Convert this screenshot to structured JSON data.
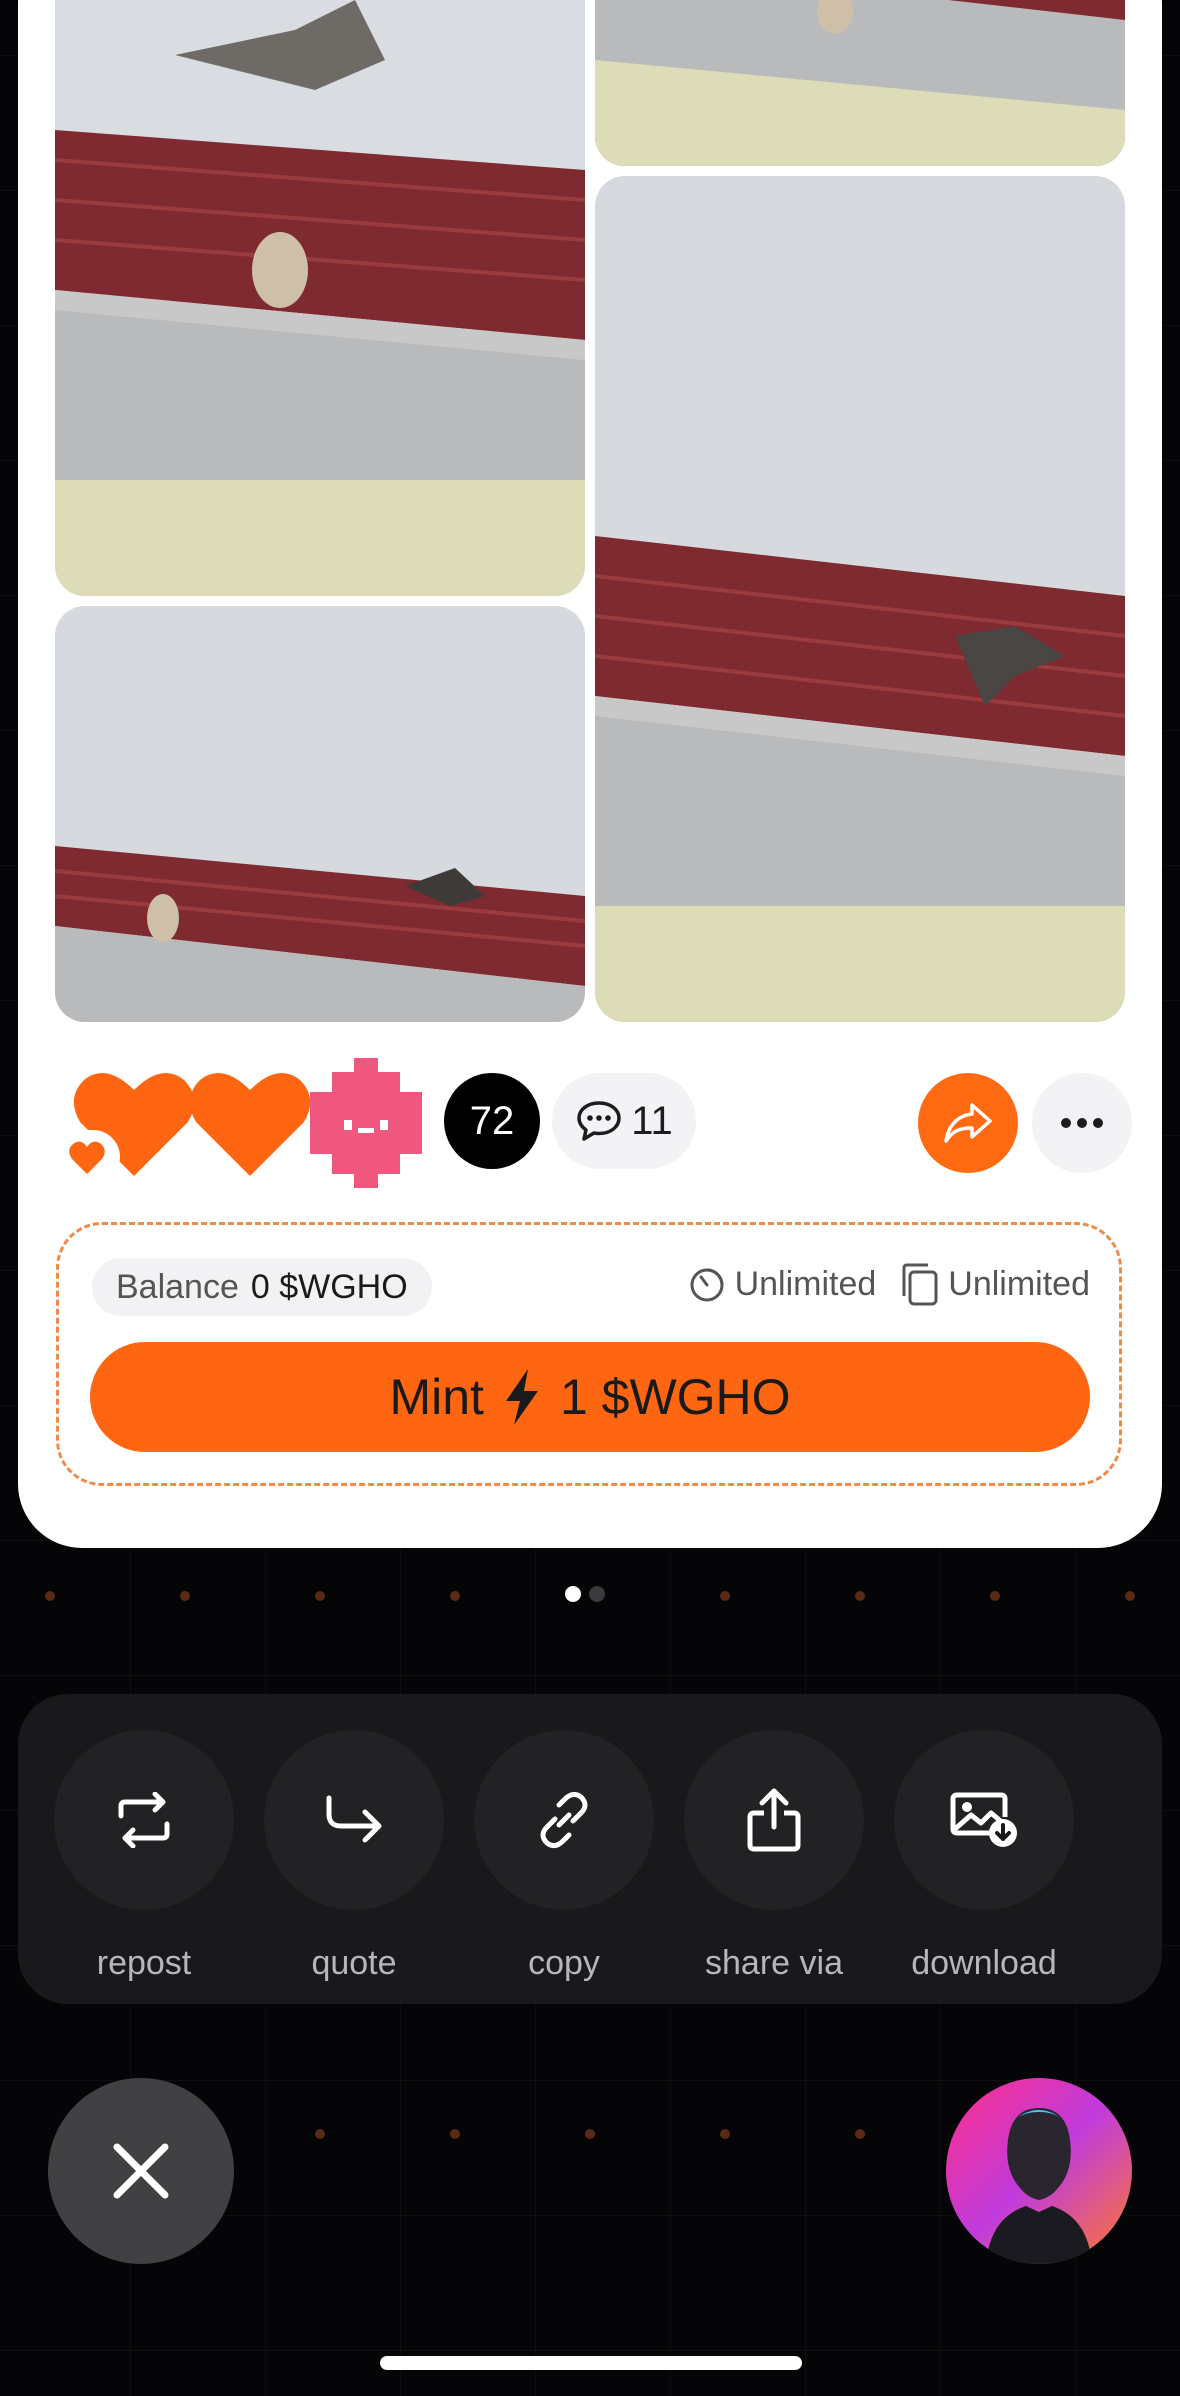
{
  "post": {
    "reaction_count": "72",
    "comment_count": "11"
  },
  "mint": {
    "balance_label": "Balance",
    "balance_value": "0 $WGHO",
    "time_limit": "Unlimited",
    "supply_limit": "Unlimited",
    "button_label_prefix": "Mint",
    "button_label_suffix": "1 $WGHO"
  },
  "pager": {
    "pages": 2,
    "active_index": 0
  },
  "share_sheet": {
    "items": [
      {
        "label": "repost",
        "icon": "repost-icon"
      },
      {
        "label": "quote",
        "icon": "quote-arrow-icon"
      },
      {
        "label": "copy",
        "icon": "link-icon"
      },
      {
        "label": "share via",
        "icon": "share-upload-icon"
      },
      {
        "label": "download",
        "icon": "download-image-icon"
      }
    ]
  },
  "colors": {
    "accent": "#ff6611",
    "background": "#050406",
    "card": "#ffffff",
    "sheet": "#19191b"
  }
}
